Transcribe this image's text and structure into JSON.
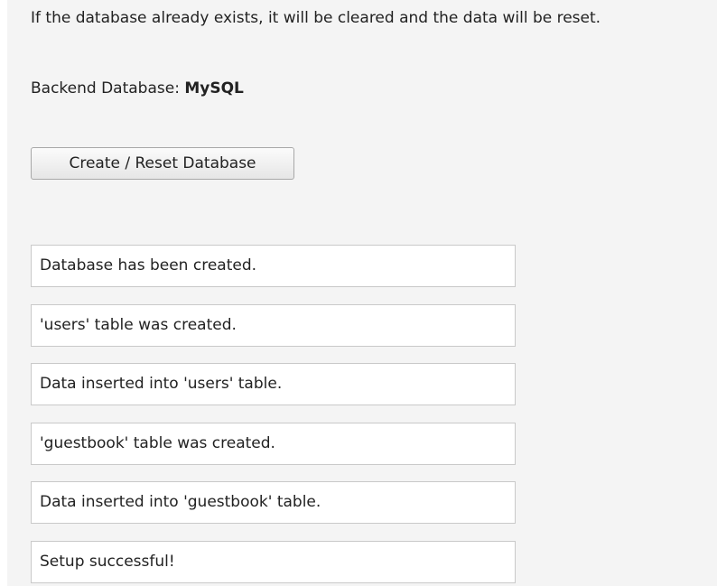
{
  "intro_text": "If the database already exists, it will be cleared and the data will be reset.",
  "backend": {
    "label": "Backend Database:",
    "value": "MySQL"
  },
  "create_button_label": "Create / Reset Database",
  "messages": [
    "Database has been created.",
    "'users' table was created.",
    "Data inserted into 'users' table.",
    "'guestbook' table was created.",
    "Data inserted into 'guestbook' table.",
    "Setup successful!"
  ]
}
